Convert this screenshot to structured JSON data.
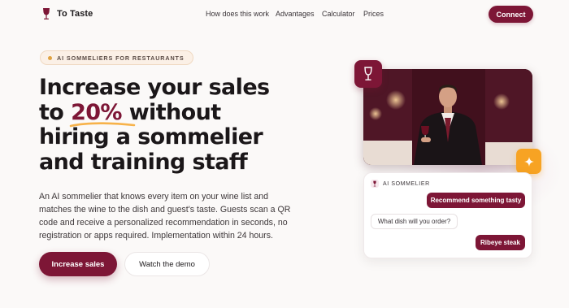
{
  "brand": {
    "name": "To Taste",
    "accent": "#7d1636",
    "highlight": "#f7a323"
  },
  "nav": {
    "items": [
      "How does this work",
      "Advantages",
      "Calculator",
      "Prices"
    ],
    "connect_label": "Connect"
  },
  "hero": {
    "badge": "AI SOMMELIERS FOR RESTAURANTS",
    "headline": {
      "line1": "Increase your sales",
      "line2_pre": "to ",
      "line2_highlight": "20%",
      "line2_post": " without",
      "line3": "hiring a sommelier",
      "line4": "and training staff"
    },
    "description": "An AI sommelier that knows every item on your wine list and matches the wine to the dish and guest's taste. Guests scan a QR code and receive a personalized recommendation in seconds, no registration or apps required. Implementation within 24 hours.",
    "primary_cta": "Increase sales",
    "secondary_cta": "Watch the demo"
  },
  "chat": {
    "title": "AI SOMMELIER",
    "messages": [
      {
        "from": "guest",
        "text": "Recommend something tasty"
      },
      {
        "from": "ai",
        "text": "What dish will you order?"
      },
      {
        "from": "guest",
        "text": "Ribeye steak"
      }
    ]
  },
  "icons": {
    "logo": "wine-glass-icon",
    "tile_top": "wine-glass-icon",
    "tile_bottom": "sparkle-icon",
    "chat_head": "wine-glass-icon"
  }
}
